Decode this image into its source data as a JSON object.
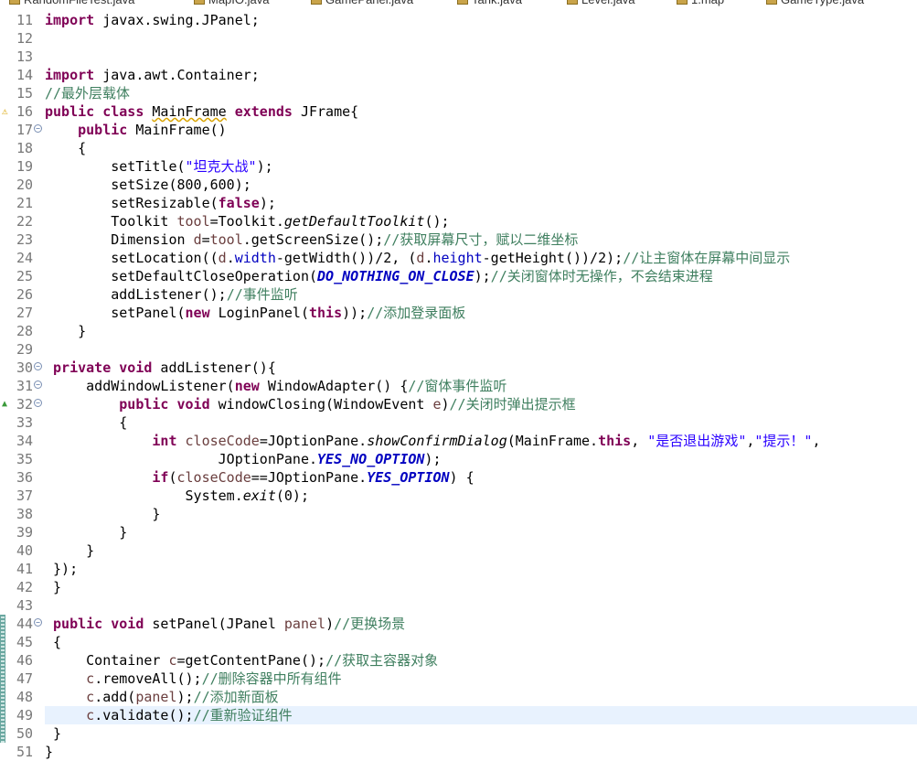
{
  "tabs": [
    {
      "label": "RandomFileTest.java"
    },
    {
      "label": "MapIO.java"
    },
    {
      "label": "GamePanel.java"
    },
    {
      "label": "Tank.java"
    },
    {
      "label": "Level.java"
    },
    {
      "label": "1.map"
    },
    {
      "label": "GameType.java"
    }
  ],
  "editor": {
    "lines": [
      {
        "n": "11",
        "indent": "",
        "tokens": [
          {
            "t": "import",
            "c": "k"
          },
          {
            "t": " javax.swing.JPanel;"
          }
        ]
      },
      {
        "n": "12",
        "tokens": []
      },
      {
        "n": "13",
        "tokens": []
      },
      {
        "n": "14",
        "tokens": [
          {
            "t": "import",
            "c": "k"
          },
          {
            "t": " java.awt.Container;"
          }
        ]
      },
      {
        "n": "15",
        "tokens": [
          {
            "t": "//最外层载体",
            "c": "c"
          }
        ]
      },
      {
        "n": "16",
        "marker": "warn",
        "tokens": [
          {
            "t": "public",
            "c": "k"
          },
          {
            "t": " "
          },
          {
            "t": "class",
            "c": "k"
          },
          {
            "t": " "
          },
          {
            "t": "MainFrame",
            "c": "warnUnderline"
          },
          {
            "t": " "
          },
          {
            "t": "extends",
            "c": "k"
          },
          {
            "t": " JFrame{"
          }
        ]
      },
      {
        "n": "17",
        "fold": true,
        "tokens": [
          {
            "t": "    "
          },
          {
            "t": "public",
            "c": "k"
          },
          {
            "t": " MainFrame()"
          }
        ]
      },
      {
        "n": "18",
        "tokens": [
          {
            "t": "    {"
          }
        ]
      },
      {
        "n": "19",
        "tokens": [
          {
            "t": "        setTitle("
          },
          {
            "t": "\"坦克大战\"",
            "c": "s"
          },
          {
            "t": ");"
          }
        ]
      },
      {
        "n": "20",
        "tokens": [
          {
            "t": "        setSize(800,600);"
          }
        ]
      },
      {
        "n": "21",
        "tokens": [
          {
            "t": "        setResizable("
          },
          {
            "t": "false",
            "c": "k"
          },
          {
            "t": ");"
          }
        ]
      },
      {
        "n": "22",
        "tokens": [
          {
            "t": "        Toolkit "
          },
          {
            "t": "tool",
            "c": "v"
          },
          {
            "t": "=Toolkit."
          },
          {
            "t": "getDefaultToolkit",
            "c": "it"
          },
          {
            "t": "();"
          }
        ]
      },
      {
        "n": "23",
        "tokens": [
          {
            "t": "        Dimension "
          },
          {
            "t": "d",
            "c": "v"
          },
          {
            "t": "="
          },
          {
            "t": "tool",
            "c": "v"
          },
          {
            "t": ".getScreenSize();"
          },
          {
            "t": "//获取屏幕尺寸，赋以二维坐标",
            "c": "c"
          }
        ]
      },
      {
        "n": "24",
        "tokens": [
          {
            "t": "        setLocation(("
          },
          {
            "t": "d",
            "c": "v"
          },
          {
            "t": "."
          },
          {
            "t": "width",
            "c": "fl"
          },
          {
            "t": "-getWidth())/2, ("
          },
          {
            "t": "d",
            "c": "v"
          },
          {
            "t": "."
          },
          {
            "t": "height",
            "c": "fl"
          },
          {
            "t": "-getHeight())/2);"
          },
          {
            "t": "//让主窗体在屏幕中间显示",
            "c": "c"
          }
        ]
      },
      {
        "n": "25",
        "tokens": [
          {
            "t": "        setDefaultCloseOperation("
          },
          {
            "t": "DO_NOTHING_ON_CLOSE",
            "c": "sc"
          },
          {
            "t": ");"
          },
          {
            "t": "//关闭窗体时无操作，不会结束进程",
            "c": "c"
          }
        ]
      },
      {
        "n": "26",
        "tokens": [
          {
            "t": "        addListener();"
          },
          {
            "t": "//事件监听",
            "c": "c"
          }
        ]
      },
      {
        "n": "27",
        "tokens": [
          {
            "t": "        setPanel("
          },
          {
            "t": "new",
            "c": "k"
          },
          {
            "t": " LoginPanel("
          },
          {
            "t": "this",
            "c": "k"
          },
          {
            "t": "));"
          },
          {
            "t": "//添加登录面板",
            "c": "c"
          }
        ]
      },
      {
        "n": "28",
        "tokens": [
          {
            "t": "    }"
          }
        ]
      },
      {
        "n": "29",
        "tokens": []
      },
      {
        "n": "30",
        "fold": true,
        "tokens": [
          {
            "t": " "
          },
          {
            "t": "private",
            "c": "k"
          },
          {
            "t": " "
          },
          {
            "t": "void",
            "c": "k"
          },
          {
            "t": " addListener(){"
          }
        ]
      },
      {
        "n": "31",
        "fold": true,
        "tokens": [
          {
            "t": "     addWindowListener("
          },
          {
            "t": "new",
            "c": "k"
          },
          {
            "t": " WindowAdapter() {"
          },
          {
            "t": "//窗体事件监听",
            "c": "c"
          }
        ]
      },
      {
        "n": "32",
        "fold": true,
        "marker": "override",
        "tokens": [
          {
            "t": "         "
          },
          {
            "t": "public",
            "c": "k"
          },
          {
            "t": " "
          },
          {
            "t": "void",
            "c": "k"
          },
          {
            "t": " windowClosing(WindowEvent "
          },
          {
            "t": "e",
            "c": "v"
          },
          {
            "t": ")"
          },
          {
            "t": "//关闭时弹出提示框",
            "c": "c"
          }
        ]
      },
      {
        "n": "33",
        "tokens": [
          {
            "t": "         {"
          }
        ]
      },
      {
        "n": "34",
        "tokens": [
          {
            "t": "             "
          },
          {
            "t": "int",
            "c": "k"
          },
          {
            "t": " "
          },
          {
            "t": "closeCode",
            "c": "v"
          },
          {
            "t": "=JOptionPane."
          },
          {
            "t": "showConfirmDialog",
            "c": "it"
          },
          {
            "t": "(MainFrame."
          },
          {
            "t": "this",
            "c": "k"
          },
          {
            "t": ", "
          },
          {
            "t": "\"是否退出游戏\"",
            "c": "s"
          },
          {
            "t": ","
          },
          {
            "t": "\"提示！\"",
            "c": "s"
          },
          {
            "t": ","
          }
        ]
      },
      {
        "n": "35",
        "tokens": [
          {
            "t": "                     JOptionPane."
          },
          {
            "t": "YES_NO_OPTION",
            "c": "sc"
          },
          {
            "t": ");"
          }
        ]
      },
      {
        "n": "36",
        "tokens": [
          {
            "t": "             "
          },
          {
            "t": "if",
            "c": "k"
          },
          {
            "t": "("
          },
          {
            "t": "closeCode",
            "c": "v"
          },
          {
            "t": "==JOptionPane."
          },
          {
            "t": "YES_OPTION",
            "c": "sc"
          },
          {
            "t": ") {"
          }
        ]
      },
      {
        "n": "37",
        "tokens": [
          {
            "t": "                 System."
          },
          {
            "t": "exit",
            "c": "it"
          },
          {
            "t": "(0);"
          }
        ]
      },
      {
        "n": "38",
        "tokens": [
          {
            "t": "             }"
          }
        ]
      },
      {
        "n": "39",
        "tokens": [
          {
            "t": "         }"
          }
        ]
      },
      {
        "n": "40",
        "tokens": [
          {
            "t": "     }"
          }
        ]
      },
      {
        "n": "41",
        "tokens": [
          {
            "t": " });"
          }
        ]
      },
      {
        "n": "42",
        "tokens": [
          {
            "t": " }"
          }
        ]
      },
      {
        "n": "43",
        "tokens": []
      },
      {
        "n": "44",
        "changed": true,
        "fold": true,
        "tokens": [
          {
            "t": " "
          },
          {
            "t": "public",
            "c": "k"
          },
          {
            "t": " "
          },
          {
            "t": "void",
            "c": "k"
          },
          {
            "t": " setPanel(JPanel "
          },
          {
            "t": "panel",
            "c": "v"
          },
          {
            "t": ")"
          },
          {
            "t": "//更换场景",
            "c": "c"
          }
        ]
      },
      {
        "n": "45",
        "changed": true,
        "tokens": [
          {
            "t": " {"
          }
        ]
      },
      {
        "n": "46",
        "changed": true,
        "tokens": [
          {
            "t": "     Container "
          },
          {
            "t": "c",
            "c": "v"
          },
          {
            "t": "=getContentPane();"
          },
          {
            "t": "//获取主容器对象",
            "c": "c"
          }
        ]
      },
      {
        "n": "47",
        "changed": true,
        "tokens": [
          {
            "t": "     "
          },
          {
            "t": "c",
            "c": "v"
          },
          {
            "t": ".removeAll();"
          },
          {
            "t": "//删除容器中所有组件",
            "c": "c"
          }
        ]
      },
      {
        "n": "48",
        "changed": true,
        "tokens": [
          {
            "t": "     "
          },
          {
            "t": "c",
            "c": "v"
          },
          {
            "t": ".add("
          },
          {
            "t": "panel",
            "c": "v"
          },
          {
            "t": ");"
          },
          {
            "t": "//添加新面板",
            "c": "c"
          }
        ]
      },
      {
        "n": "49",
        "changed": true,
        "highlight": true,
        "tokens": [
          {
            "t": "     "
          },
          {
            "t": "c",
            "c": "v"
          },
          {
            "t": ".validate();"
          },
          {
            "t": "//重新验证组件",
            "c": "c"
          }
        ]
      },
      {
        "n": "50",
        "changed": true,
        "tokens": [
          {
            "t": " }"
          }
        ]
      },
      {
        "n": "51",
        "tokens": [
          {
            "t": "}"
          }
        ]
      }
    ]
  },
  "colors": {
    "keyword": "#7f0055",
    "string": "#2a00ff",
    "comment": "#3f7f5f",
    "field": "#0000c0",
    "localVar": "#6a3e3e",
    "lineNumber": "#787878",
    "currentLine": "#e8f2fe",
    "changeRuler": "#6aa7a0"
  },
  "icons": {
    "warning": "warning-icon",
    "override": "override-arrow-icon",
    "fold": "fold-collapse-icon",
    "javaFile": "java-file-icon"
  }
}
